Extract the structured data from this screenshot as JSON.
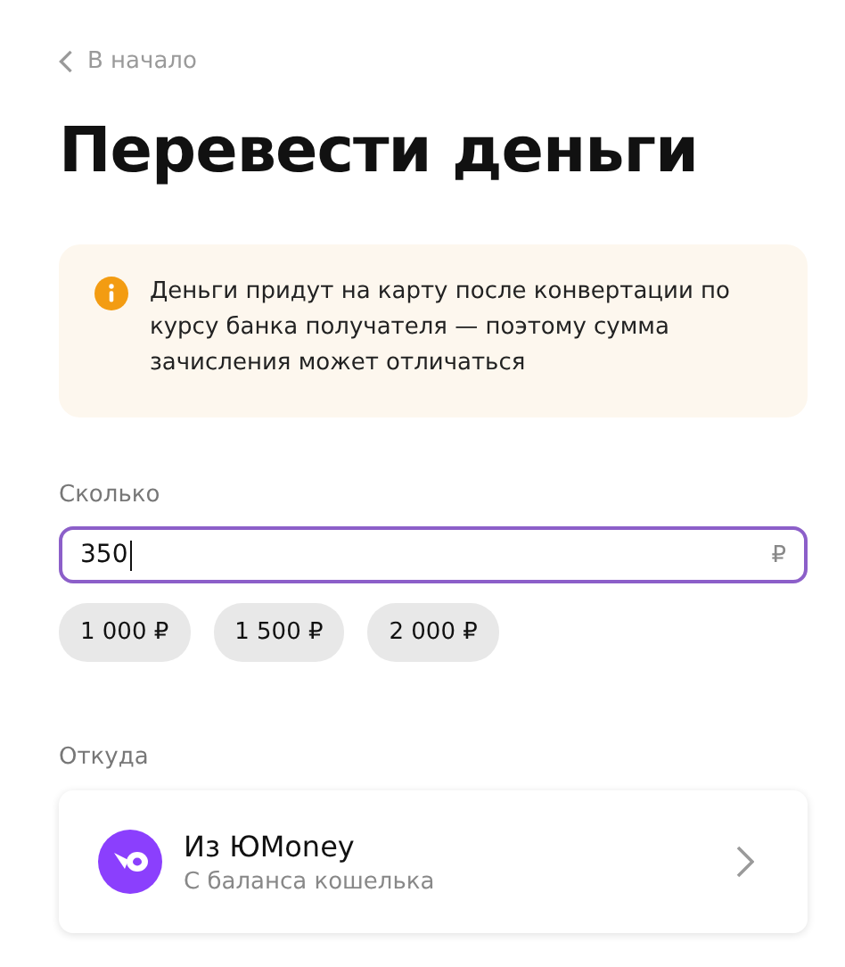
{
  "back_link": "В начало",
  "title": "Перевести деньги",
  "notice": {
    "text": "Деньги придут на карту после конвертации по курсу банка получателя — поэтому сумма зачисления может отличаться"
  },
  "amount": {
    "label": "Сколько",
    "value": "350",
    "currency": "₽"
  },
  "quick_amounts": [
    {
      "label": "1 000 ₽"
    },
    {
      "label": "1 500 ₽"
    },
    {
      "label": "2 000 ₽"
    }
  ],
  "source": {
    "label": "Откуда",
    "title": "Из ЮMoney",
    "subtitle": "С баланса кошелька"
  }
}
